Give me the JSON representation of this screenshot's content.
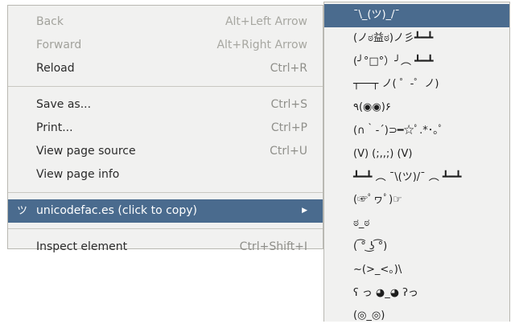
{
  "context_menu": {
    "group1": [
      {
        "label": "Back",
        "shortcut": "Alt+Left Arrow"
      },
      {
        "label": "Forward",
        "shortcut": "Alt+Right Arrow"
      },
      {
        "label": "Reload",
        "shortcut": "Ctrl+R"
      }
    ],
    "group2": [
      {
        "label": "Save as...",
        "shortcut": "Ctrl+S"
      },
      {
        "label": "Print...",
        "shortcut": "Ctrl+P"
      },
      {
        "label": "View page source",
        "shortcut": "Ctrl+U"
      },
      {
        "label": "View page info",
        "shortcut": ""
      }
    ],
    "extension": {
      "icon": "ツ",
      "label": "unicodefac.es (click to copy)",
      "arrow": "▶"
    },
    "inspect": {
      "label": "Inspect element",
      "shortcut": "Ctrl+Shift+I"
    }
  },
  "submenu": {
    "faces": [
      "¯\\_(ツ)_/¯",
      "(ノಠ益ಠ)ノ彡┻━┻",
      "(╯°□°）╯︵ ┻━┻",
      "┬──┬ ノ( ゜-゜ノ)",
      "٩(◉◉)۶",
      "(∩｀-´)⊃━☆ﾟ.*･｡ﾟ",
      "(V) (;,,;) (V)",
      "┻━┻ ︵ ¯\\(ツ)/¯ ︵ ┻━┻",
      "(☞ﾟヮﾟ)☞",
      "ಠ_ಠ",
      "( ͡° ͜ʖ ͡°)",
      "~(>_<。)\\",
      "ʕ っ ◕_◕ ʔっ",
      "(◎_◎)"
    ]
  }
}
